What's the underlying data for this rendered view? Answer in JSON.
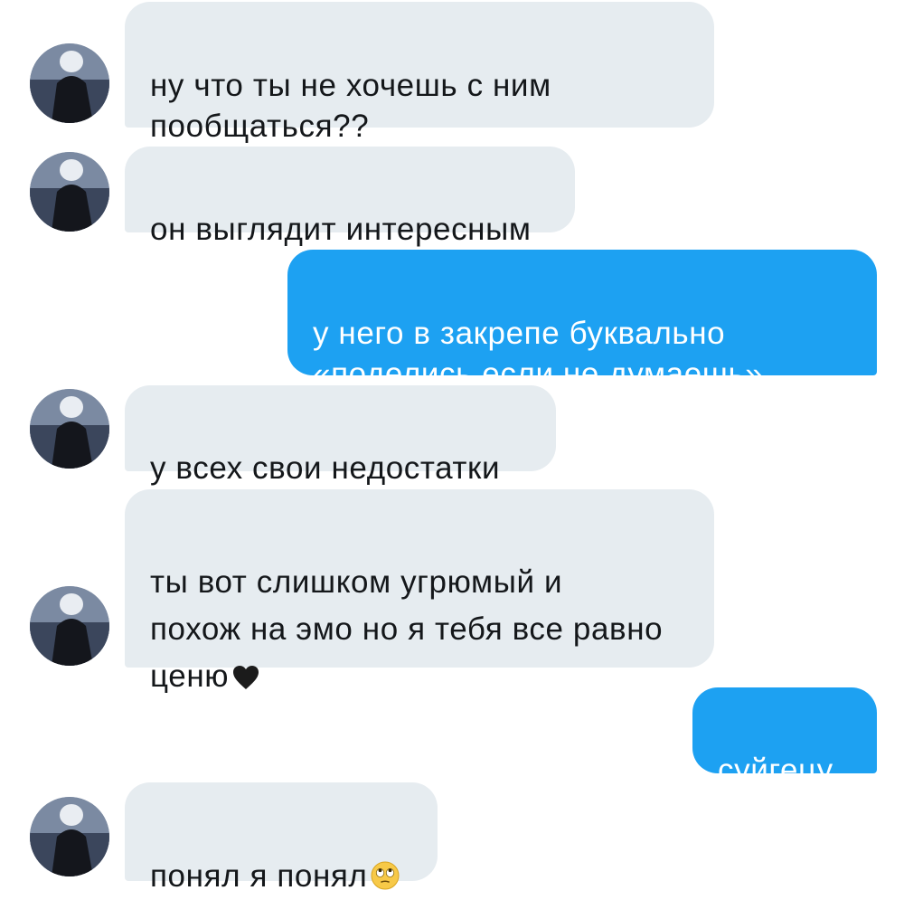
{
  "conversation": {
    "messages": [
      {
        "sender": "other",
        "text": " ну что ты не хочешь с ним\nпообщаться??"
      },
      {
        "sender": "other",
        "text": "он выглядит интересным"
      },
      {
        "sender": "me",
        "text": "у него в закрепе буквально\n«поделись если не думаешь»"
      },
      {
        "sender": "other",
        "text": "у всех свои недостатки"
      },
      {
        "sender": "other",
        "text": "ты вот слишком угрюмый и\nпохож на эмо но я тебя все равно\nценю",
        "emoji": "black-heart-icon"
      },
      {
        "sender": "me",
        "text": "суйгецу."
      },
      {
        "sender": "other",
        "text": "понял я понял",
        "emoji": "eye-roll-face-icon"
      }
    ]
  },
  "colors": {
    "incoming_bubble": "#e6ecf0",
    "outgoing_bubble": "#1da1f2",
    "incoming_text": "#14171a",
    "outgoing_text": "#ffffff"
  }
}
